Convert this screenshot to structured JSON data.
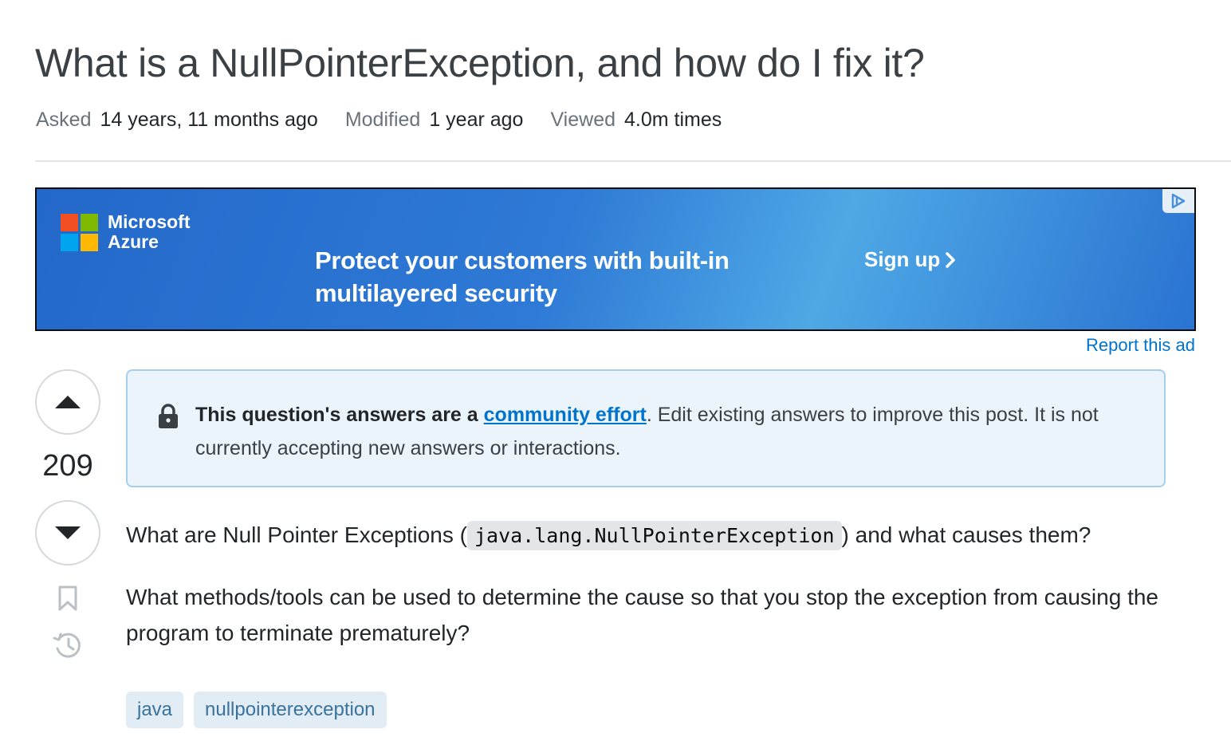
{
  "question": {
    "title": "What is a NullPointerException, and how do I fix it?",
    "meta": [
      {
        "label": "Asked",
        "value": "14 years, 11 months ago"
      },
      {
        "label": "Modified",
        "value": "1 year ago"
      },
      {
        "label": "Viewed",
        "value": "4.0m times"
      }
    ],
    "vote_count": "209",
    "body": {
      "p1_before": "What are Null Pointer Exceptions (",
      "p1_code": "java.lang.NullPointerException",
      "p1_after": ") and what causes them?",
      "p2": "What methods/tools can be used to determine the cause so that you stop the exception from causing the program to terminate prematurely?"
    },
    "tags": [
      "java",
      "nullpointerexception"
    ]
  },
  "ad": {
    "brand_line1": "Microsoft",
    "brand_line2": "Azure",
    "headline_line1": "Protect your customers with built-in",
    "headline_line2": "multilayered security",
    "cta": "Sign up",
    "cta_icon": "chevron-right-icon",
    "report_link": "Report this ad",
    "logo_colors": [
      "#f25022",
      "#7fba00",
      "#00a4ef",
      "#ffb900"
    ]
  },
  "notice": {
    "bold_text": "This question's answers are a ",
    "link_text": "community effort",
    "rest_text": ". Edit existing answers to improve this post. It is not currently accepting new answers or interactions.",
    "icon": "lock-icon"
  },
  "icons": {
    "upvote": "arrow-up-icon",
    "downvote": "arrow-down-icon",
    "bookmark": "bookmark-icon",
    "history": "history-icon"
  },
  "colors": {
    "link": "#0074cc",
    "tag_bg": "#e1ecf4",
    "tag_text": "#39739d",
    "notice_bg": "#ebf4fb",
    "notice_border": "#a6ceed"
  }
}
